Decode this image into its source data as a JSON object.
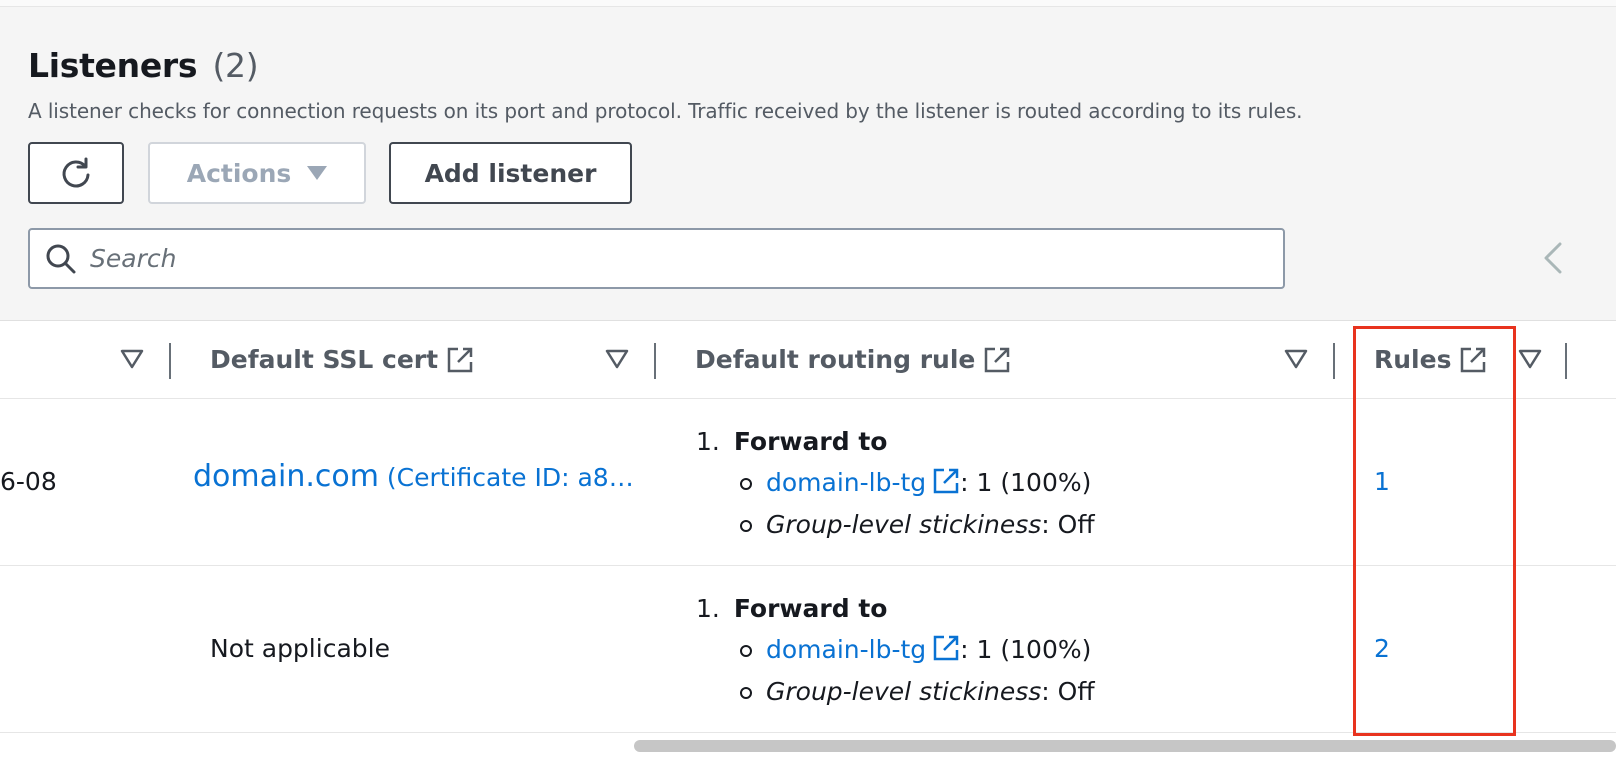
{
  "header": {
    "title": "Listeners",
    "count": "(2)",
    "description": "A listener checks for connection requests on its port and protocol. Traffic received by the listener is routed according to its rules."
  },
  "toolbar": {
    "refresh_icon": "refresh-icon",
    "actions_label": "Actions",
    "add_listener_label": "Add listener"
  },
  "search": {
    "placeholder": "Search",
    "value": ""
  },
  "columns": [
    {
      "label": "Default SSL cert",
      "external_icon": "external-link-icon"
    },
    {
      "label": "Default routing rule",
      "external_icon": "external-link-icon"
    },
    {
      "label": "Rules",
      "external_icon": "external-link-icon"
    }
  ],
  "rows": [
    {
      "first_cell": "6-08",
      "ssl_cert_domain": "domain.com",
      "ssl_cert_id": "(Certificate ID: a8…",
      "routing": {
        "index": "1.",
        "action": "Forward to",
        "target": "domain-lb-tg",
        "target_weight": ": 1 (100%)",
        "stickiness_label": "Group-level stickiness",
        "stickiness_value": ": Off"
      },
      "rules_count": "1"
    },
    {
      "first_cell": "",
      "ssl_cert_text": "Not applicable",
      "routing": {
        "index": "1.",
        "action": "Forward to",
        "target": "domain-lb-tg",
        "target_weight": ": 1 (100%)",
        "stickiness_label": "Group-level stickiness",
        "stickiness_value": ": Off"
      },
      "rules_count": "2"
    }
  ],
  "colors": {
    "link": "#0972d3",
    "highlight": "#e8331e",
    "text": "#16191f",
    "muted": "#545b64"
  }
}
